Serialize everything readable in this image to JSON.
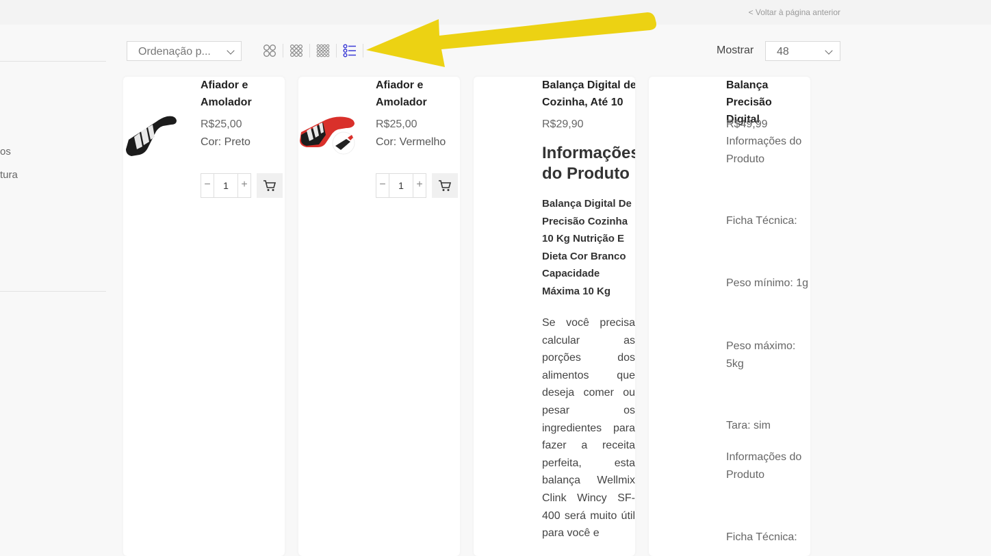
{
  "header": {
    "back_link": "< Voltar à página anterior"
  },
  "sidebar": {
    "item_1": "os",
    "item_2": "tura"
  },
  "toolbar": {
    "sort_value": "Ordenação p...",
    "view_icons": [
      "grid-2-icon",
      "grid-3-icon",
      "grid-4-icon",
      "list-view-icon"
    ],
    "show_label": "Mostrar",
    "show_value": "48"
  },
  "products": [
    {
      "name": "Afiador e Amolador",
      "price": "R$25,00",
      "color": "Cor: Preto",
      "qty": "1"
    },
    {
      "name": "Afiador e Amolador",
      "price": "R$25,00",
      "color": "Cor: Vermelho",
      "qty": "1"
    },
    {
      "name": "Balança Digital de Cozinha, Até 10",
      "price": "R$29,90",
      "desc_title": "Informações do Produto",
      "desc_bold": "Balança Digital De Precisão Cozinha 10 Kg Nutrição E Dieta Cor Branco Capacidade Máxima 10 Kg",
      "desc_text": "Se você precisa calcular as porções dos alimentos que deseja comer ou pesar os ingredientes para fazer a receita perfeita, esta balança Wellmix Clink Wincy SF-400 será muito útil para você e"
    },
    {
      "name": "Balança Precisão Digital",
      "price": "R$49,99",
      "specs": [
        "Informações do Produto",
        "Ficha Técnica:",
        "Peso mínimo: 1g",
        "Peso máximo: 5kg",
        "Tara: sim",
        "Informações do Produto",
        "Ficha Técnica:"
      ]
    }
  ],
  "colors": {
    "arrow": "#ecd213",
    "list_icon_active": "#3b3bd6",
    "knife_red": "#d9302b"
  }
}
